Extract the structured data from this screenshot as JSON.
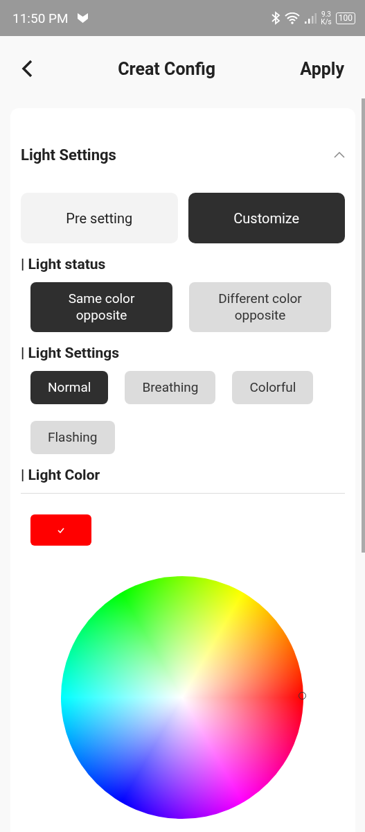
{
  "status_bar": {
    "time": "11:50 PM",
    "speed_value": "9.3",
    "speed_unit": "K/s",
    "battery": "100"
  },
  "header": {
    "title": "Creat Config",
    "action": "Apply"
  },
  "panel": {
    "title": "Light Settings",
    "expanded": true,
    "tabs": [
      {
        "label": "Pre setting",
        "selected": false
      },
      {
        "label": "Customize",
        "selected": true
      }
    ],
    "groups": [
      {
        "title": "| Light status",
        "kind": "pair",
        "options": [
          {
            "label": "Same color\nopposite",
            "selected": true
          },
          {
            "label": "Different color\nopposite",
            "selected": false
          }
        ]
      },
      {
        "title": "| Light Settings",
        "kind": "chips",
        "options": [
          {
            "label": "Normal",
            "selected": true
          },
          {
            "label": "Breathing",
            "selected": false
          },
          {
            "label": "Colorful",
            "selected": false
          },
          {
            "label": "Flashing",
            "selected": false
          }
        ]
      }
    ],
    "color_title": "| Light Color",
    "swatches": [
      {
        "color": "#ff0000",
        "selected": true
      }
    ]
  }
}
